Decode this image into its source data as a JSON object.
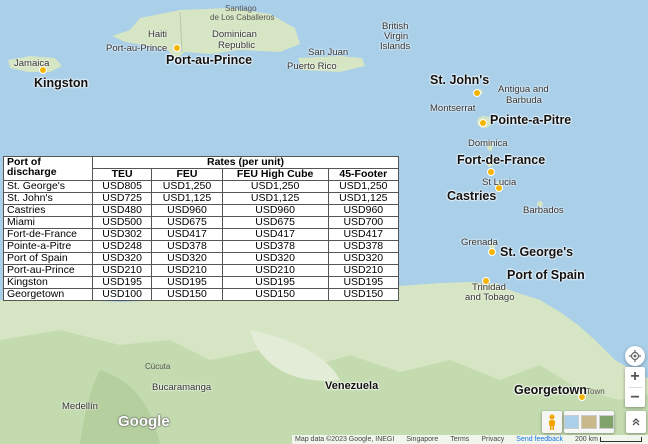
{
  "map": {
    "cities_major": [
      {
        "name": "Kingston"
      },
      {
        "name": "Port-au-Prince"
      },
      {
        "name": "St. John's"
      },
      {
        "name": "Pointe-a-Pitre"
      },
      {
        "name": "Fort-de-France"
      },
      {
        "name": "Castries"
      },
      {
        "name": "St. George's"
      },
      {
        "name": "Port of Spain"
      },
      {
        "name": "Georgetown"
      }
    ],
    "labels": {
      "haiti": "Haiti",
      "santiago": "Santiago",
      "de_los": "de Los Caballeros",
      "dominican": "Dominican",
      "republic": "Republic",
      "port_au_prince_small": "Port-au-Prince",
      "jamaica": "Jamaica",
      "san_juan": "San Juan",
      "puerto_rico": "Puerto Rico",
      "bvi1": "British",
      "bvi2": "Virgin",
      "bvi3": "Islands",
      "antigua": "Antigua and",
      "barbuda": "Barbuda",
      "montserrat": "Montserrat",
      "dominica": "Dominica",
      "st_lucia": "St Lucia",
      "barbados": "Barbados",
      "grenada": "Grenada",
      "trinidad": "Trinidad",
      "tobago": "and Tobago",
      "venezuela": "Venezuela",
      "medellin": "Medellín",
      "bucaramanga": "Bucaramanga",
      "cucuta": "Cúcuta",
      "town": "Town"
    },
    "footer": {
      "data": "Map data ©2023 Google, INEGI",
      "singapore": "Singapore",
      "terms": "Terms",
      "privacy": "Privacy",
      "feedback": "Send feedback",
      "scale": "200 km"
    },
    "google_logo": "Google",
    "controls": {
      "zoom_in": "+",
      "zoom_out": "−"
    }
  },
  "table": {
    "port_header": "Port of discharge",
    "rates_header": "Rates (per unit)",
    "cols": [
      "TEU",
      "FEU",
      "FEU High Cube",
      "45-Footer"
    ],
    "rows": [
      {
        "port": "St. George's",
        "v": [
          "USD805",
          "USD1,250",
          "USD1,250",
          "USD1,250"
        ]
      },
      {
        "port": "St. John's",
        "v": [
          "USD725",
          "USD1,125",
          "USD1,125",
          "USD1,125"
        ]
      },
      {
        "port": "Castries",
        "v": [
          "USD480",
          "USD960",
          "USD960",
          "USD960"
        ]
      },
      {
        "port": "Miami",
        "v": [
          "USD500",
          "USD675",
          "USD675",
          "USD700"
        ]
      },
      {
        "port": "Fort-de-France",
        "v": [
          "USD302",
          "USD417",
          "USD417",
          "USD417"
        ]
      },
      {
        "port": "Pointe-a-Pitre",
        "v": [
          "USD248",
          "USD378",
          "USD378",
          "USD378"
        ]
      },
      {
        "port": "Port of Spain",
        "v": [
          "USD320",
          "USD320",
          "USD320",
          "USD320"
        ]
      },
      {
        "port": "Port-au-Prince",
        "v": [
          "USD210",
          "USD210",
          "USD210",
          "USD210"
        ]
      },
      {
        "port": "Kingston",
        "v": [
          "USD195",
          "USD195",
          "USD195",
          "USD195"
        ]
      },
      {
        "port": "Georgetown",
        "v": [
          "USD100",
          "USD150",
          "USD150",
          "USD150"
        ]
      }
    ]
  },
  "colors": {
    "sea": "#a9cfe9",
    "land": "#d9e6c9",
    "land_dark": "#b9d1a3",
    "marker": "#f4b400"
  }
}
